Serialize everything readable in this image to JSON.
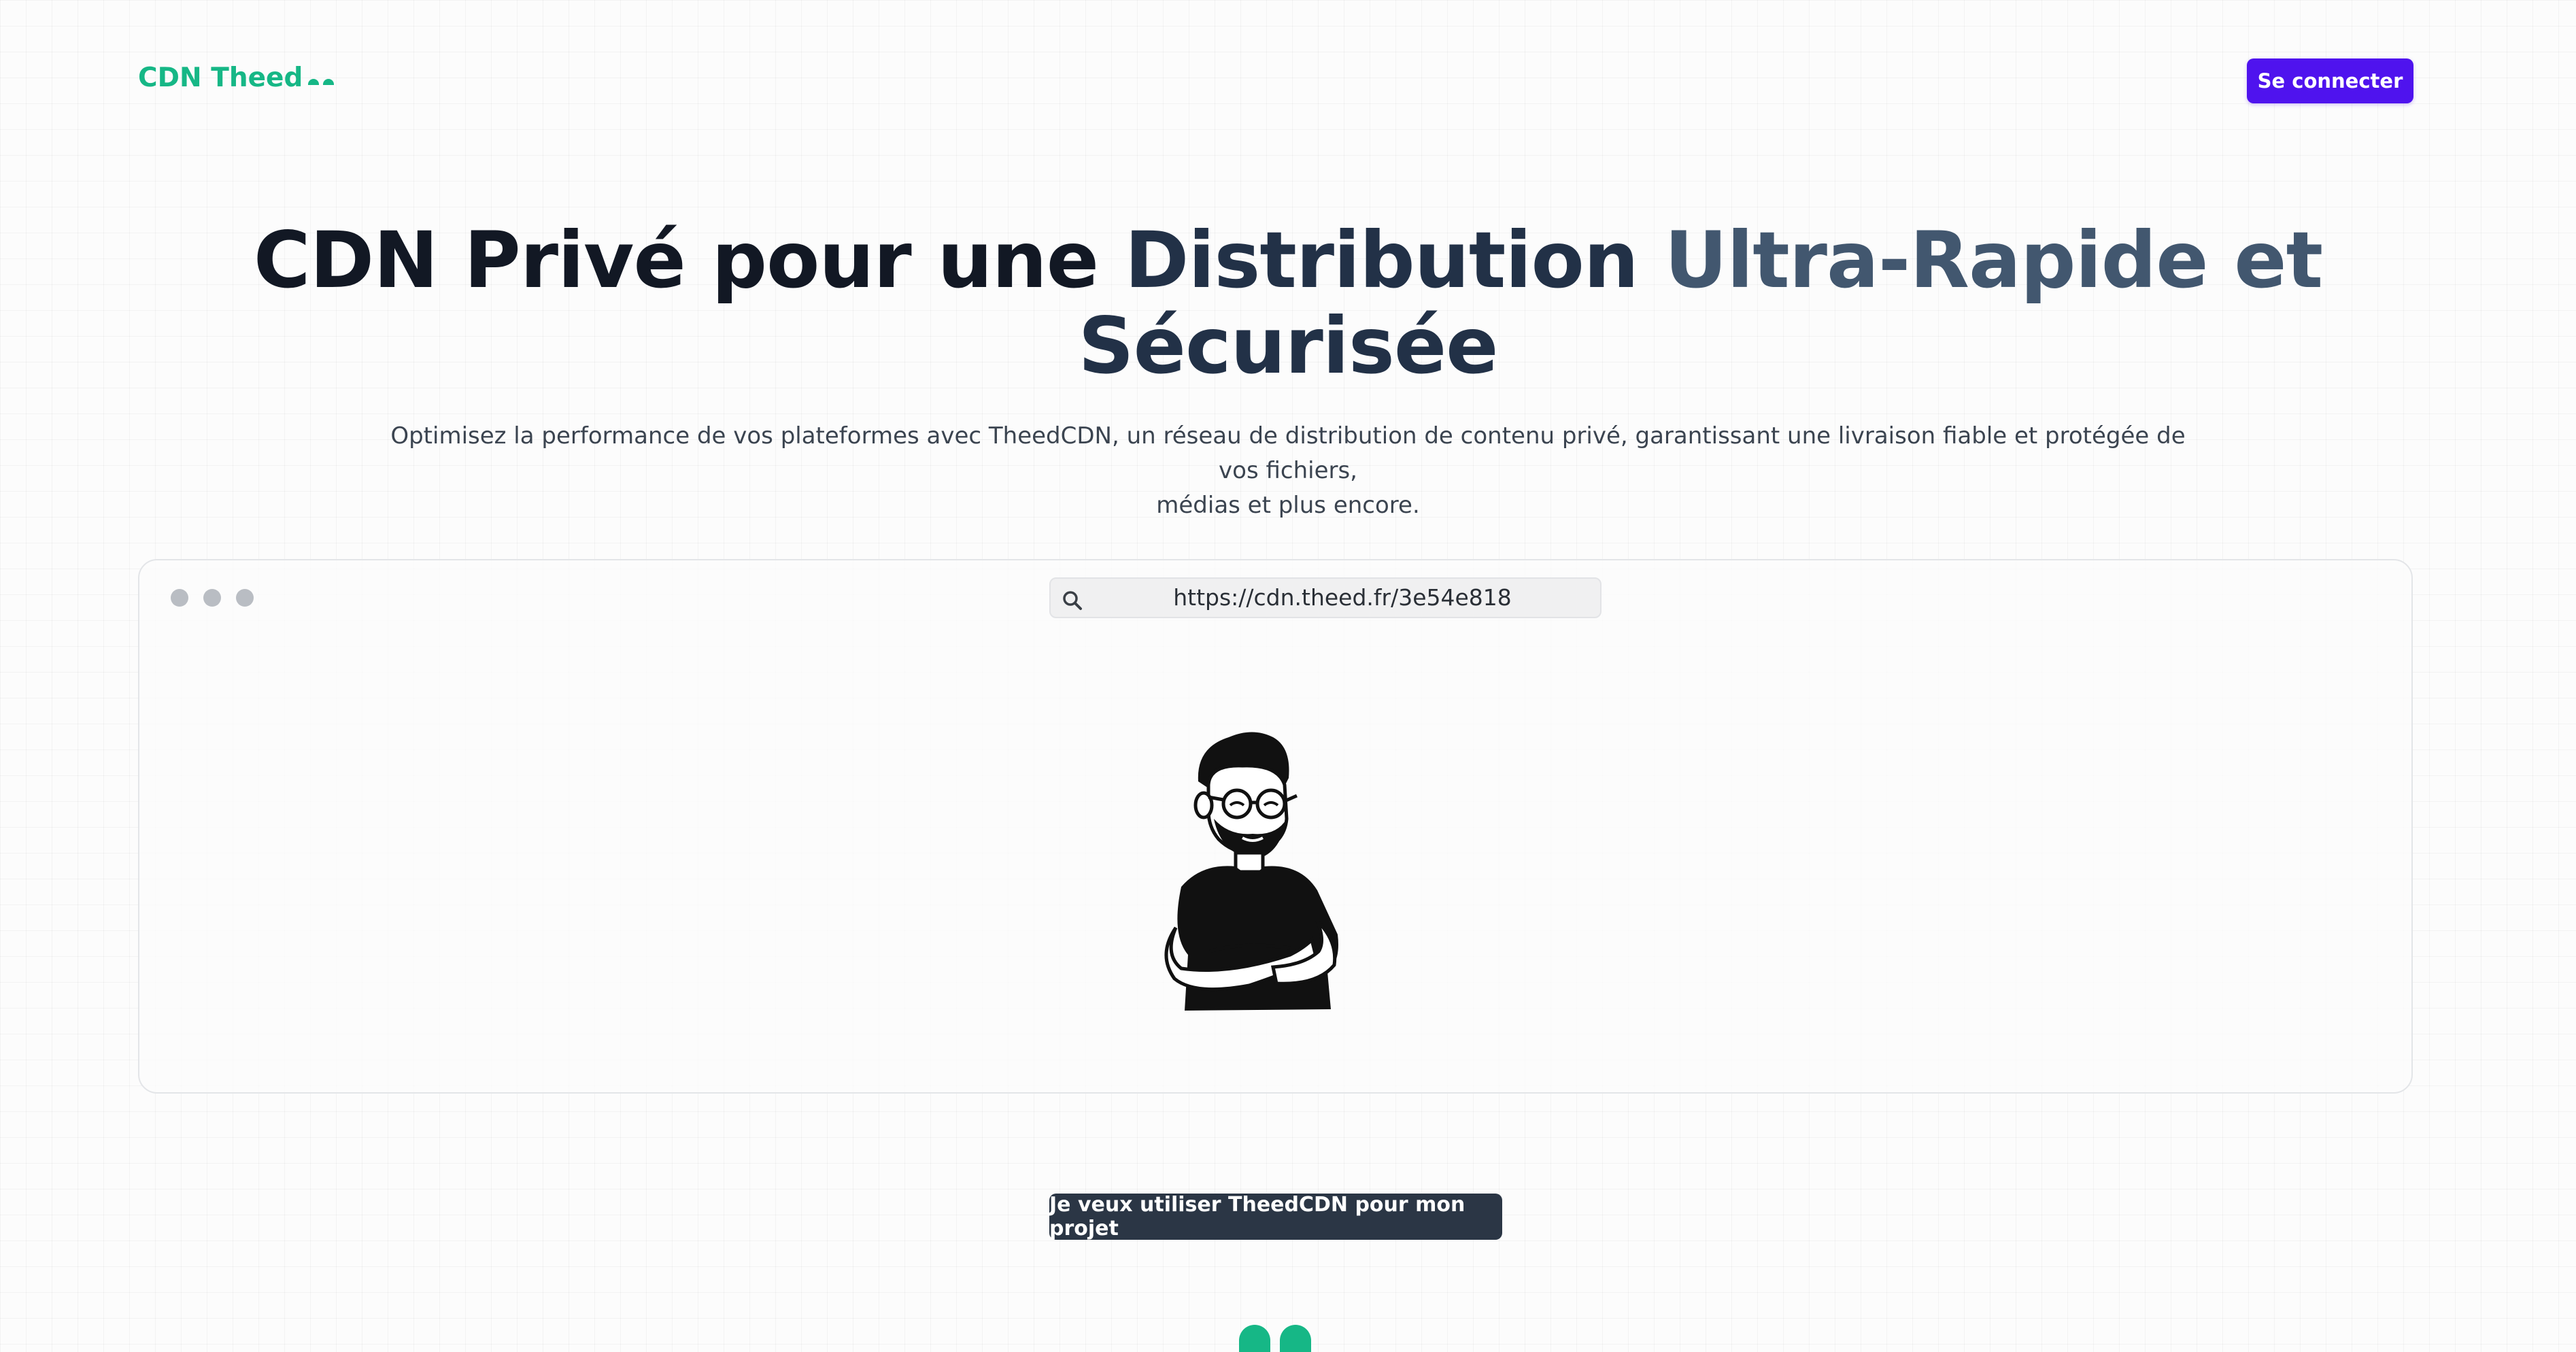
{
  "header": {
    "logo_text": "CDN Theed",
    "logo_mark_icon": "theed-ears-icon",
    "login_label": "Se connecter"
  },
  "hero": {
    "title_part1": "CDN Privé pour une ",
    "title_part2": "Distribution ",
    "title_part3": "Ultra-Rapide et",
    "title_part4": "Sécurisée",
    "subtitle_line1": "Optimisez la performance de vos plateformes avec TheedCDN, un réseau de distribution de contenu privé, garantissant une livraison fiable et protégée de vos fichiers,",
    "subtitle_line2": "médias et plus encore."
  },
  "browser": {
    "url": "https://cdn.theed.fr/3e54e818",
    "search_icon": "search-icon",
    "illustration": "man-arms-crossed-illustration"
  },
  "cta": {
    "label": "Je veux utiliser TheedCDN pour mon projet"
  },
  "colors": {
    "brand_green": "#16b786",
    "primary_purple": "#4f13ee",
    "cta_dark": "#2b3645"
  }
}
